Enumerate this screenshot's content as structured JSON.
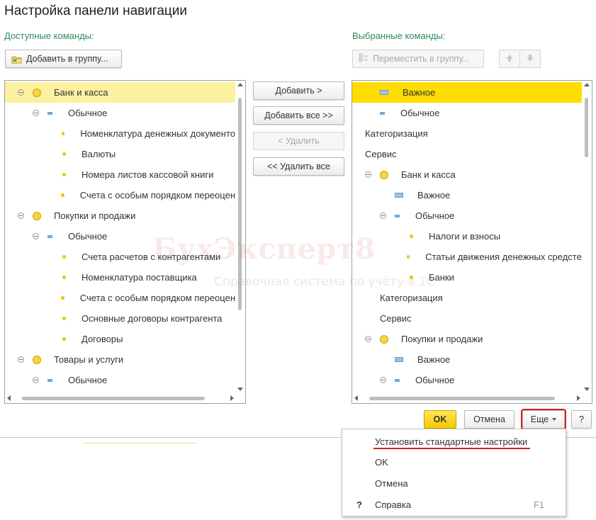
{
  "window": {
    "title": "Настройка панели навигации"
  },
  "available": {
    "label": "Доступные команды:",
    "add_to_group_label": "Добавить в группу...",
    "tree": [
      {
        "text": "Банк и касса",
        "level": 0,
        "icon": "circle-big",
        "expander": true,
        "selected": true
      },
      {
        "text": "Обычное",
        "level": 1,
        "icon": "rect-blue-sm",
        "expander": true
      },
      {
        "text": "Номенклатура денежных документо",
        "level": 2,
        "icon": "dot-small"
      },
      {
        "text": "Валюты",
        "level": 2,
        "icon": "dot-small"
      },
      {
        "text": "Номера листов кассовой книги",
        "level": 2,
        "icon": "dot-small"
      },
      {
        "text": "Счета с особым порядком переоцен",
        "level": 2,
        "icon": "dot-small"
      },
      {
        "text": "Покупки и продажи",
        "level": 0,
        "icon": "circle-big",
        "expander": true
      },
      {
        "text": "Обычное",
        "level": 1,
        "icon": "rect-blue-sm",
        "expander": true
      },
      {
        "text": "Счета расчетов с контрагентами",
        "level": 2,
        "icon": "dot-small"
      },
      {
        "text": "Номенклатура поставщика",
        "level": 2,
        "icon": "dot-small"
      },
      {
        "text": "Счета с особым порядком переоцен",
        "level": 2,
        "icon": "dot-small"
      },
      {
        "text": "Основные договоры контрагента",
        "level": 2,
        "icon": "dot-small"
      },
      {
        "text": "Договоры",
        "level": 2,
        "icon": "dot-small"
      },
      {
        "text": "Товары и услуги",
        "level": 0,
        "icon": "circle-big",
        "expander": true
      },
      {
        "text": "Обычное",
        "level": 1,
        "icon": "rect-blue-sm",
        "expander": true
      }
    ]
  },
  "middle": {
    "add_label": "Добавить >",
    "add_all_label": "Добавить все >>",
    "remove_label": "< Удалить",
    "remove_all_label": "<< Удалить все"
  },
  "selected": {
    "label": "Выбранные команды:",
    "move_to_group_label": "Переместить в группу...",
    "tree": [
      {
        "text": "Важное",
        "level": 0,
        "icon": "rect-blue-lg",
        "selected": true
      },
      {
        "text": "Обычное",
        "level": 0,
        "icon": "rect-blue-sm"
      },
      {
        "text": "Категоризация",
        "level": 0,
        "icon": "none"
      },
      {
        "text": "Сервис",
        "level": 0,
        "icon": "none"
      },
      {
        "text": "Банк и касса",
        "level": 0,
        "icon": "circle-big",
        "expander": true
      },
      {
        "text": "Важное",
        "level": 1,
        "icon": "rect-blue-lg"
      },
      {
        "text": "Обычное",
        "level": 1,
        "icon": "rect-blue-sm",
        "expander": true
      },
      {
        "text": "Налоги и взносы",
        "level": 2,
        "icon": "dot-small"
      },
      {
        "text": "Статьи движения денежных средстe",
        "level": 2,
        "icon": "dot-small"
      },
      {
        "text": "Банки",
        "level": 2,
        "icon": "dot-small"
      },
      {
        "text": "Категоризация",
        "level": 1,
        "icon": "none"
      },
      {
        "text": "Сервис",
        "level": 1,
        "icon": "none"
      },
      {
        "text": "Покупки и продажи",
        "level": 0,
        "icon": "circle-big",
        "expander": true
      },
      {
        "text": "Важное",
        "level": 1,
        "icon": "rect-blue-lg"
      },
      {
        "text": "Обычное",
        "level": 1,
        "icon": "rect-blue-sm",
        "expander": true
      }
    ]
  },
  "footer": {
    "ok_label": "OK",
    "cancel_label": "Отмена",
    "more_label": "Еще",
    "help_label": "?"
  },
  "more_menu": {
    "items": [
      {
        "label": "Установить стандартные настройки",
        "icon": "",
        "shortcut": ""
      },
      {
        "label": "OK",
        "icon": "",
        "shortcut": ""
      },
      {
        "label": "Отмена",
        "icon": "",
        "shortcut": ""
      },
      {
        "label": "Справка",
        "icon": "?",
        "shortcut": "F1"
      }
    ]
  },
  "watermark": {
    "brand": "БухЭксперт8",
    "tagline": "Справочная система по учёту в 1С"
  },
  "colors": {
    "accent_green": "#2e8b57",
    "selection_yellow": "#fbf19f",
    "selection_yellow_strong": "#ffdd00",
    "primary_button": "#f5c800",
    "highlight_red": "#d62020"
  }
}
